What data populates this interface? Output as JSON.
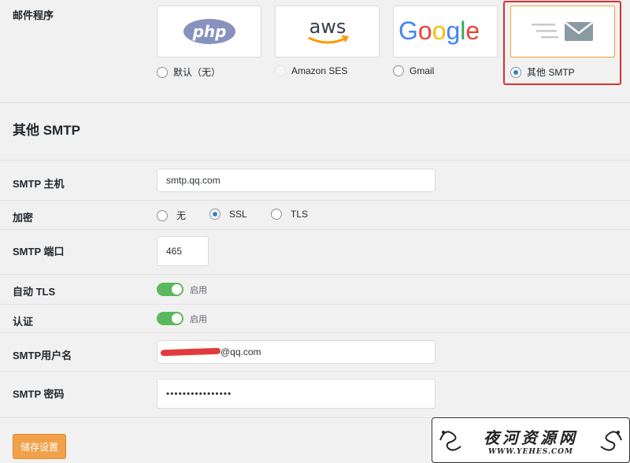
{
  "mailer": {
    "label": "邮件程序",
    "options": [
      {
        "logo": "php",
        "label": "默认（无）",
        "checked": false,
        "disabled": false
      },
      {
        "logo": "aws",
        "label": "Amazon SES",
        "checked": false,
        "disabled": true
      },
      {
        "logo": "Google",
        "label": "Gmail",
        "checked": false,
        "disabled": false
      },
      {
        "logo": "mail-icon",
        "label": "其他 SMTP",
        "checked": true,
        "disabled": false
      }
    ]
  },
  "section_title": "其他 SMTP",
  "smtp_host": {
    "label": "SMTP 主机",
    "value": "smtp.qq.com"
  },
  "encryption": {
    "label": "加密",
    "options": [
      {
        "label": "无",
        "checked": false
      },
      {
        "label": "SSL",
        "checked": true
      },
      {
        "label": "TLS",
        "checked": false
      }
    ]
  },
  "smtp_port": {
    "label": "SMTP 端口",
    "value": "465"
  },
  "auto_tls": {
    "label": "自动 TLS",
    "toggle_label": "启用",
    "enabled": true
  },
  "auth": {
    "label": "认证",
    "toggle_label": "启用",
    "enabled": true
  },
  "smtp_username": {
    "label": "SMTP用户名",
    "value_suffix": "@qq.com"
  },
  "smtp_password": {
    "label": "SMTP 密码",
    "value": "••••••••••••••••"
  },
  "save_button": "储存设置",
  "watermark": {
    "title": "夜河资源网",
    "url": "WWW.YEHES.COM"
  },
  "colors": {
    "accent": "#3582c4",
    "toggle_on": "#5cb85c",
    "save": "#f0a14a",
    "highlight_border": "#d93030"
  }
}
